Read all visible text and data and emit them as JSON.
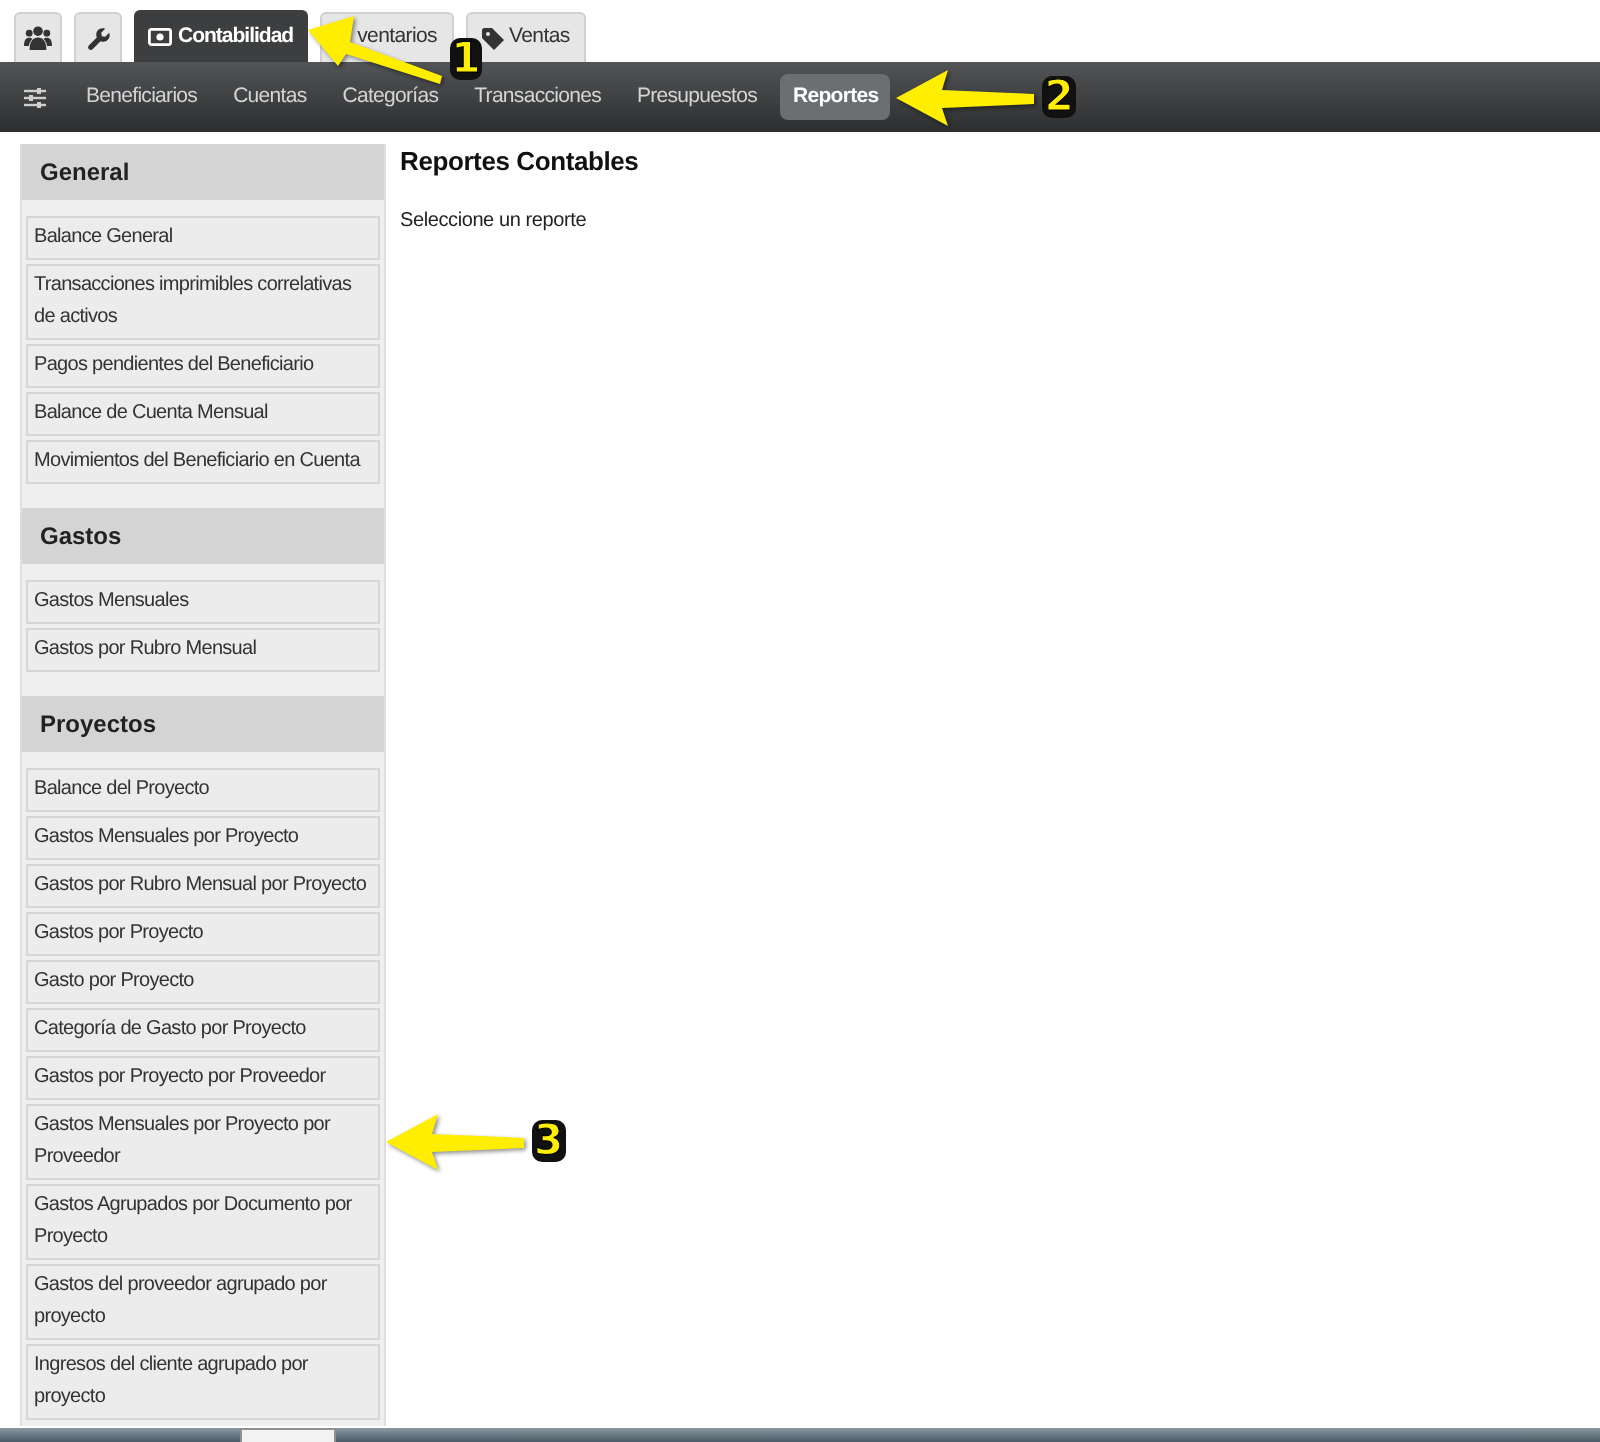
{
  "tabs": [
    {
      "kind": "icon",
      "selected": false
    },
    {
      "kind": "icon",
      "selected": false
    },
    {
      "kind": "text",
      "label": "Contabilidad",
      "selected": true,
      "callout": "1"
    },
    {
      "kind": "text",
      "label": "ventarios",
      "selected": false
    },
    {
      "kind": "text",
      "label": "Ventas",
      "selected": false
    }
  ],
  "navbar": {
    "items": [
      {
        "label": "Beneficiarios",
        "selected": false
      },
      {
        "label": "Cuentas",
        "selected": false
      },
      {
        "label": "Categorías",
        "selected": false
      },
      {
        "label": "Transacciones",
        "selected": false
      },
      {
        "label": "Presupuestos",
        "selected": false
      },
      {
        "label": "Reportes",
        "selected": true,
        "callout": "2"
      }
    ]
  },
  "sidebar": {
    "sections": [
      {
        "title": "General",
        "items": [
          {
            "label": "Balance General"
          },
          {
            "label": "Transacciones imprimibles correlativas de activos"
          },
          {
            "label": "Pagos pendientes del Beneficiario"
          },
          {
            "label": "Balance de Cuenta Mensual"
          },
          {
            "label": "Movimientos del Beneficiario en Cuenta"
          }
        ]
      },
      {
        "title": "Gastos",
        "items": [
          {
            "label": "Gastos Mensuales"
          },
          {
            "label": "Gastos por Rubro Mensual"
          }
        ]
      },
      {
        "title": "Proyectos",
        "items": [
          {
            "label": "Balance del Proyecto"
          },
          {
            "label": "Gastos Mensuales por Proyecto"
          },
          {
            "label": "Gastos por Rubro Mensual por Proyecto"
          },
          {
            "label": "Gastos por Proyecto"
          },
          {
            "label": "Gasto por Proyecto"
          },
          {
            "label": "Categoría de Gasto por Proyecto"
          },
          {
            "label": "Gastos por Proyecto por Proveedor"
          },
          {
            "label": "Gastos Mensuales por Proyecto por Proveedor",
            "callout": "3"
          },
          {
            "label": "Gastos Agrupados por Documento por Proyecto"
          },
          {
            "label": "Gastos del proveedor agrupado por proyecto"
          },
          {
            "label": "Ingresos del cliente agrupado por proyecto"
          }
        ]
      }
    ]
  },
  "content": {
    "title": "Reportes Contables",
    "text": "Seleccione un reporte"
  }
}
